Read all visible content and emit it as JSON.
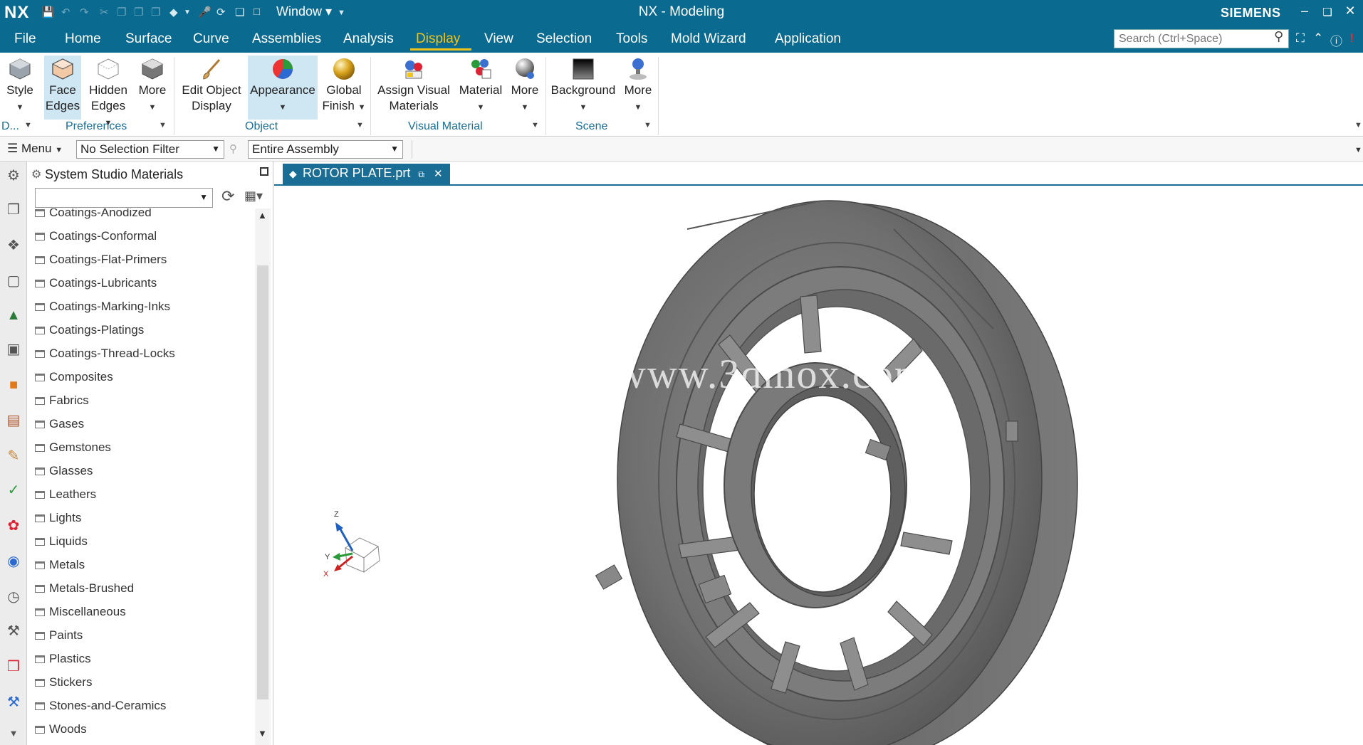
{
  "titlebar": {
    "logo": "NX",
    "window_menu": "Window ▾",
    "title": "NX - Modeling",
    "brand": "SIEMENS"
  },
  "tabs": [
    {
      "label": "File"
    },
    {
      "label": "Home"
    },
    {
      "label": "Surface"
    },
    {
      "label": "Curve"
    },
    {
      "label": "Assemblies"
    },
    {
      "label": "Analysis"
    },
    {
      "label": "Display"
    },
    {
      "label": "View"
    },
    {
      "label": "Selection"
    },
    {
      "label": "Tools"
    },
    {
      "label": "Mold Wizard"
    },
    {
      "label": "Application"
    }
  ],
  "search": {
    "placeholder": "Search (Ctrl+Space)"
  },
  "ribbon": {
    "style": "Style",
    "face_edges": "Face Edges",
    "face_edges_l1": "Face",
    "face_edges_l2": "Edges",
    "hidden_edges_l1": "Hidden",
    "hidden_edges_l2": "Edges",
    "more1": "More",
    "edit_obj_l1": "Edit Object",
    "edit_obj_l2": "Display",
    "appearance": "Appearance",
    "global_finish_l1": "Global",
    "global_finish_l2": "Finish",
    "assign_vm_l1": "Assign Visual",
    "assign_vm_l2": "Materials",
    "material": "Material",
    "more2": "More",
    "background": "Background",
    "more3": "More",
    "groups": {
      "d": "D...",
      "preferences": "Preferences",
      "object": "Object",
      "visual_material": "Visual Material",
      "scene": "Scene"
    }
  },
  "selbar": {
    "menu": "Menu",
    "filter": "No Selection Filter",
    "scope": "Entire Assembly"
  },
  "panel": {
    "title": "System Studio Materials",
    "items": [
      "Coatings-Anodized",
      "Coatings-Conformal",
      "Coatings-Flat-Primers",
      "Coatings-Lubricants",
      "Coatings-Marking-Inks",
      "Coatings-Platings",
      "Coatings-Thread-Locks",
      "Composites",
      "Fabrics",
      "Gases",
      "Gemstones",
      "Glasses",
      "Leathers",
      "Lights",
      "Liquids",
      "Metals",
      "Metals-Brushed",
      "Miscellaneous",
      "Paints",
      "Plastics",
      "Stickers",
      "Stones-and-Ceramics",
      "Woods"
    ]
  },
  "document": {
    "tab_label": "ROTOR PLATE.prt",
    "watermark": "www.3dmox.com"
  },
  "triad": {
    "z": "Z",
    "y": "Y",
    "x": "X"
  },
  "colors": {
    "titlebar": "#0b6a8f",
    "active_tab": "#f0c419",
    "group_label": "#1a6e95",
    "part_gray": "#6e6e6e"
  }
}
